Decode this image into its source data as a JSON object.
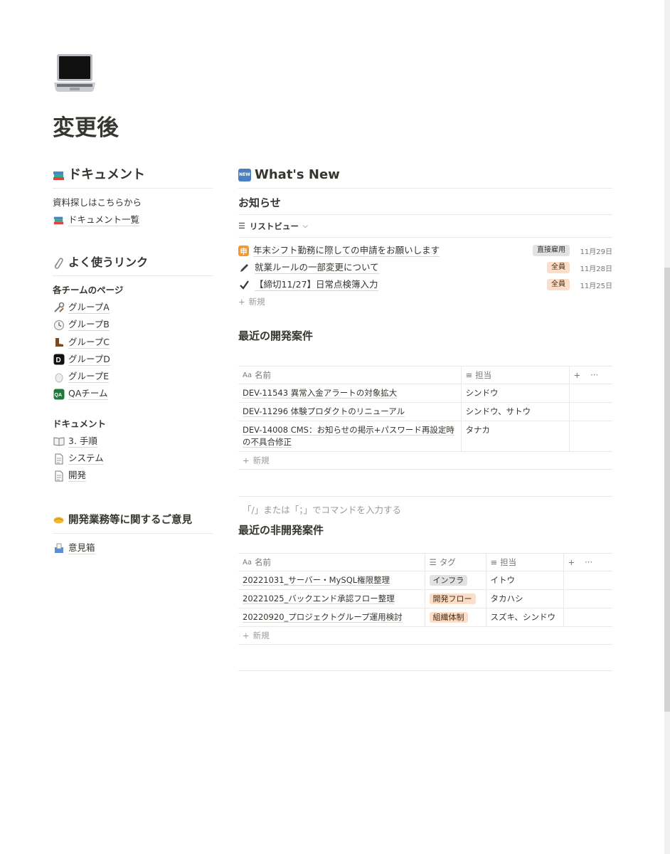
{
  "page": {
    "title": "変更後"
  },
  "docs": {
    "heading": "ドキュメント",
    "intro": "資料探しはこちらから",
    "link": "ドキュメント一覧"
  },
  "links": {
    "heading": "よく使うリンク",
    "teams_heading": "各チームのページ",
    "teams": [
      {
        "label": "グループA",
        "icon": "tools-icon"
      },
      {
        "label": "グループB",
        "icon": "clock-icon"
      },
      {
        "label": "グループC",
        "icon": "boot-icon"
      },
      {
        "label": "グループD",
        "icon": "d-badge-icon"
      },
      {
        "label": "グループE",
        "icon": "egg-icon"
      },
      {
        "label": "QAチーム",
        "icon": "qa-badge-icon"
      }
    ],
    "docs_heading": "ドキュメント",
    "docs": [
      {
        "label": "3. 手順",
        "icon": "book-icon"
      },
      {
        "label": "システム",
        "icon": "page-icon"
      },
      {
        "label": "開発",
        "icon": "page-icon"
      }
    ]
  },
  "feedback": {
    "heading": "開発業務等に関するご意見",
    "link": "意見箱"
  },
  "whatsnew": {
    "badge": "NEW",
    "heading": "What's New",
    "notices_heading": "お知らせ",
    "view_label": "リストビュー",
    "items": [
      {
        "title": "年末シフト勤務に際しての申請をお願いします",
        "tag": "直接雇用",
        "date": "11月29日",
        "icon": "shin-badge-icon",
        "icon_text": "申"
      },
      {
        "title": "就業ルールの一部変更について",
        "tag": "全員",
        "date": "11月28日",
        "icon": "pen-icon"
      },
      {
        "title": "【締切11/27】日常点検簿入力",
        "tag": "全員",
        "date": "11月25日",
        "icon": "check-icon"
      }
    ],
    "new_label": "新規"
  },
  "dev": {
    "heading": "最近の開発案件",
    "col_name_prefix": "Aa",
    "col_name": "名前",
    "col_owner": "担当",
    "rows": [
      {
        "name": "DEV-11543 異常入金アラートの対象拡大",
        "owner": "シンドウ"
      },
      {
        "name": "DEV-11296 体験プロダクトのリニューアル",
        "owner": "シンドウ、サトウ"
      },
      {
        "name": "DEV-14008 CMS：お知らせの掲示+パスワード再設定時の不具合修正",
        "owner": "タナカ"
      }
    ],
    "new_label": "新規"
  },
  "command_hint": "「/」または「；」でコマンドを入力する",
  "nondev": {
    "heading": "最近の非開発案件",
    "col_name_prefix": "Aa",
    "col_name": "名前",
    "col_tag": "タグ",
    "col_owner": "担当",
    "rows": [
      {
        "name": "20221031_サーバー・MySQL権限整理",
        "tag": "インフラ",
        "owner": "イトウ"
      },
      {
        "name": "20221025_バックエンド承認フロー整理",
        "tag": "開発フロー",
        "owner": "タカハシ"
      },
      {
        "name": "20220920_プロジェクトグループ運用検討",
        "tag": "組織体制",
        "owner": "スズキ、シンドウ"
      }
    ],
    "new_label": "新規"
  },
  "colors": {
    "text": "#37352f",
    "muted": "#9b9a97",
    "tag_gray": "#e3e2e0",
    "tag_orange": "#fadec9"
  }
}
